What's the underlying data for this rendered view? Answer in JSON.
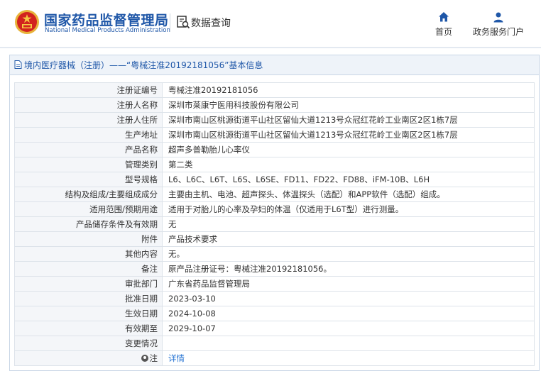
{
  "header": {
    "brand_cn": "国家药品监督管理局",
    "brand_en": "National Medical Products Administration",
    "query_label": "数据查询",
    "nav": [
      {
        "label": "首页",
        "icon": "home-icon"
      },
      {
        "label": "政务服务门户",
        "icon": "user-icon"
      }
    ]
  },
  "panel": {
    "title": "境内医疗器械（注册）——“粤械注准20192181056”基本信息"
  },
  "rows": [
    {
      "label": "注册证编号",
      "value": "粤械注准20192181056"
    },
    {
      "label": "注册人名称",
      "value": "深圳市莱康宁医用科技股份有限公司"
    },
    {
      "label": "注册人住所",
      "value": "深圳市南山区桃源街道平山社区留仙大道1213号众冠红花岭工业南区2区1栋7层"
    },
    {
      "label": "生产地址",
      "value": "深圳市南山区桃源街道平山社区留仙大道1213号众冠红花岭工业南区2区1栋7层"
    },
    {
      "label": "产品名称",
      "value": "超声多普勒胎儿心率仪"
    },
    {
      "label": "管理类别",
      "value": "第二类"
    },
    {
      "label": "型号规格",
      "value": "L6、L6C、L6T、L6S、L6SE、FD11、FD22、FD88、iFM-10B、L6H"
    },
    {
      "label": "结构及组成/主要组成成分",
      "value": "主要由主机、电池、超声探头、体温探头（选配）和APP软件（选配）组成。"
    },
    {
      "label": "适用范围/预期用途",
      "value": "适用于对胎儿的心率及孕妇的体温（仅适用于L6T型）进行测量。"
    },
    {
      "label": "产品储存条件及有效期",
      "value": "无"
    },
    {
      "label": "附件",
      "value": "产品技术要求"
    },
    {
      "label": "其他内容",
      "value": "无。"
    },
    {
      "label": "备注",
      "value": "原产品注册证号：粤械注准20192181056。"
    },
    {
      "label": "审批部门",
      "value": "广东省药品监督管理局"
    },
    {
      "label": "批准日期",
      "value": "2023-03-10"
    },
    {
      "label": "生效日期",
      "value": "2024-10-08"
    },
    {
      "label": "有效期至",
      "value": "2029-10-07"
    },
    {
      "label": "变更情况",
      "value": ""
    }
  ],
  "note_row": {
    "label": "注",
    "link": "详情"
  }
}
